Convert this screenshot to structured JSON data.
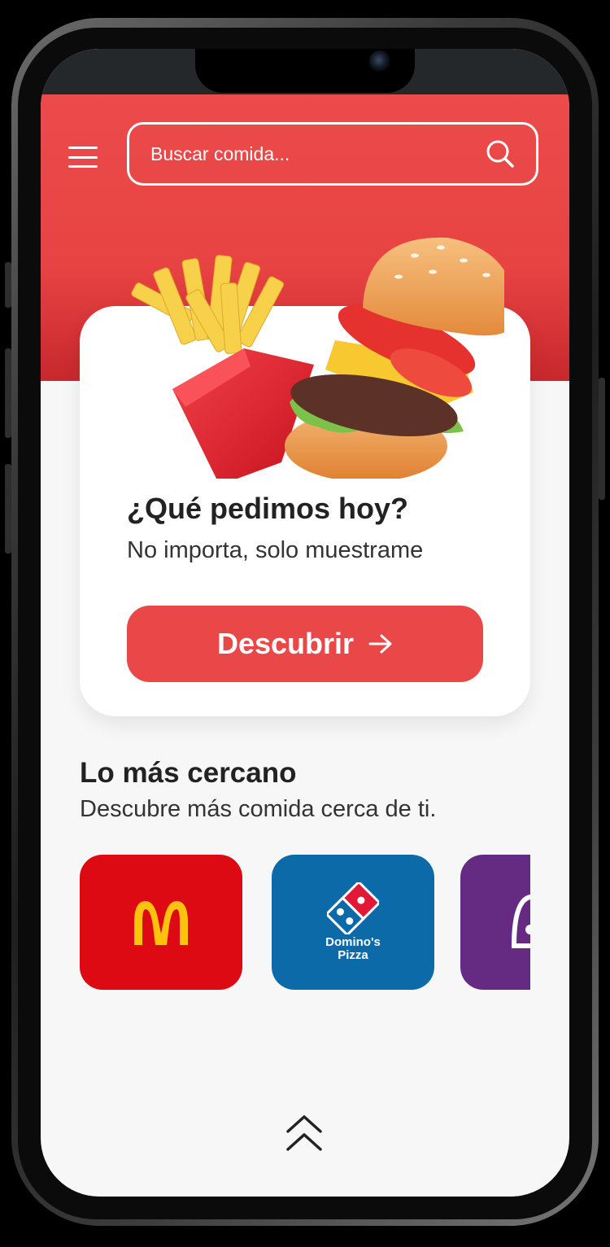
{
  "search": {
    "placeholder": "Buscar comida..."
  },
  "hero_card": {
    "title": "¿Qué pedimos hoy?",
    "subtitle": "No importa, solo muestrame",
    "button_label": "Descubrir"
  },
  "nearby": {
    "title": "Lo más cercano",
    "subtitle": "Descubre más comida cerca de ti.",
    "restaurants": [
      {
        "name": "McDonald's",
        "bg": "#de0a13"
      },
      {
        "name": "Domino's Pizza",
        "logo_line1": "Domino's",
        "logo_line2": "Pizza",
        "bg": "#0c6aa8"
      },
      {
        "name": "Taco Bell",
        "bg": "#652b82"
      }
    ]
  },
  "colors": {
    "primary": "#ea4848",
    "header": "#e84343",
    "text_dark": "#222222",
    "background": "#f7f7f7"
  },
  "icons": [
    "menu-icon",
    "search-icon",
    "arrow-right-icon",
    "double-chevron-up-icon"
  ]
}
